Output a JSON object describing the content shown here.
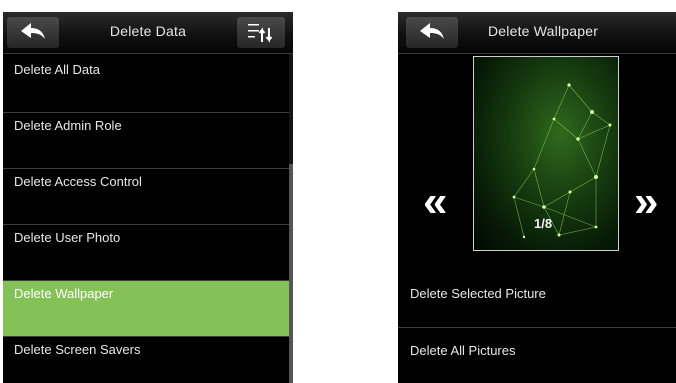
{
  "left_screen": {
    "title": "Delete Data",
    "menu_items": [
      {
        "label": "Delete All Data"
      },
      {
        "label": "Delete Admin Role"
      },
      {
        "label": "Delete Access Control"
      },
      {
        "label": "Delete User Photo"
      },
      {
        "label": "Delete Wallpaper",
        "selected": true
      },
      {
        "label": "Delete Screen Savers"
      }
    ],
    "icons": [
      "back-arrow-icon",
      "sort-icon"
    ],
    "highlight_color": "#84c257"
  },
  "right_screen": {
    "title": "Delete Wallpaper",
    "counter": "1/8",
    "prev_symbol": "«",
    "next_symbol": "»",
    "menu_items": [
      {
        "label": "Delete Selected Picture"
      },
      {
        "label": "Delete All Pictures"
      }
    ],
    "icons": [
      "back-arrow-icon",
      "left-double-arrow-icon",
      "right-double-arrow-icon"
    ]
  }
}
